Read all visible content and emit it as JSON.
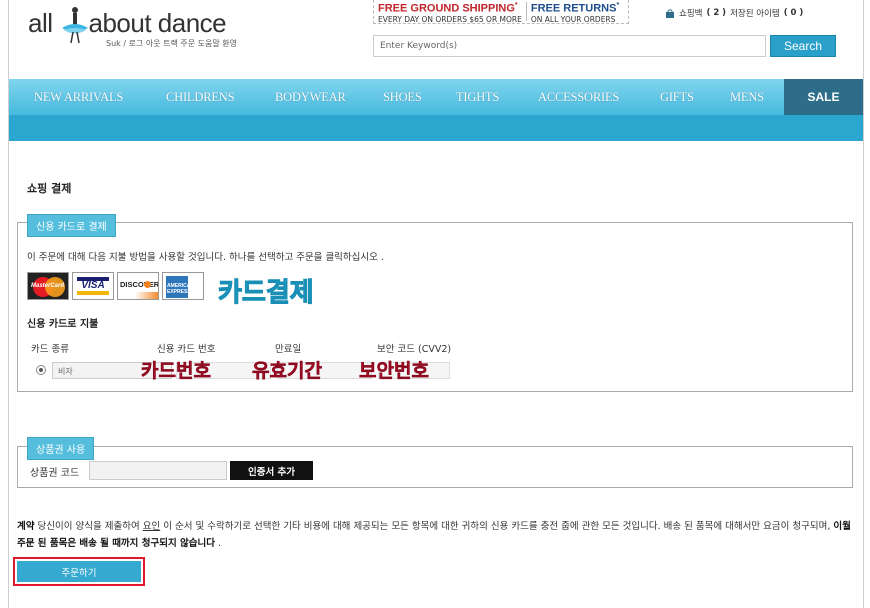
{
  "header": {
    "logo_left": "all",
    "logo_right": "about dance",
    "sub_links": "Suk  / 로그 아웃  트랙 주문  도움말  환영",
    "promo": {
      "shipping_title": "FREE GROUND SHIPPING",
      "shipping_sub": "EVERY DAY ON ORDERS $65 OR MORE",
      "returns_title": "FREE RETURNS",
      "returns_sub": "ON ALL YOUR ORDERS",
      "asterisk": "*"
    },
    "cart": {
      "label": "쇼핑백",
      "count": "( 2 )",
      "saved_label": "저장된 아이템",
      "saved_count": "( 0 )"
    },
    "search": {
      "placeholder": "Enter Keyword(s)",
      "button": "Search"
    }
  },
  "nav": {
    "items": [
      "NEW ARRIVALS",
      "CHILDRENS",
      "BODYWEAR",
      "SHOES",
      "TIGHTS",
      "ACCESSORIES",
      "GIFTS",
      "MENS"
    ],
    "sale": "SALE"
  },
  "checkout": {
    "title": "쇼핑 결제",
    "credit": {
      "legend": "신용 카드로 결제",
      "description": "이 주문에 대해 다음 지불 방법을 사용할 것입니다. 하나를 선택하고 주문을 클릭하십시오 .",
      "cards": [
        "MasterCard",
        "VISA",
        "DISCOVER",
        "AMERICAN EXPRESS"
      ],
      "sub_title": "신용 카드로 지불",
      "columns": [
        "카드 종류",
        "신용 카드 번호",
        "만료일",
        "보안 코드 (CVV2)"
      ],
      "selected_type": "비자",
      "annotation_card": "카드결제",
      "annotation_number": "카드번호",
      "annotation_expiry": "유효기간",
      "annotation_cvv": "보안번호"
    },
    "gift": {
      "legend": "상품권 사용",
      "label": "상품권 코드",
      "button": "인증서 추가"
    },
    "terms": {
      "bold_start": "계약",
      "text_a": " 당신이이 양식을 제출하여 ",
      "underlined": "요인",
      "text_b": " 이 순서 및 수락하기로 선택한 기타 비용에 대해 제공되는 모든 항목에 대한 귀하의 신용 카드를 충전 줍에 관한 모든 것입니다. 배송 된 품목에 대해서만 요금이 청구되며, ",
      "bold_end": "이월 주문 된 품목은 배송 될 때까지 청구되지 않습니다",
      "text_end": " ."
    },
    "order_button": "주문하기"
  }
}
